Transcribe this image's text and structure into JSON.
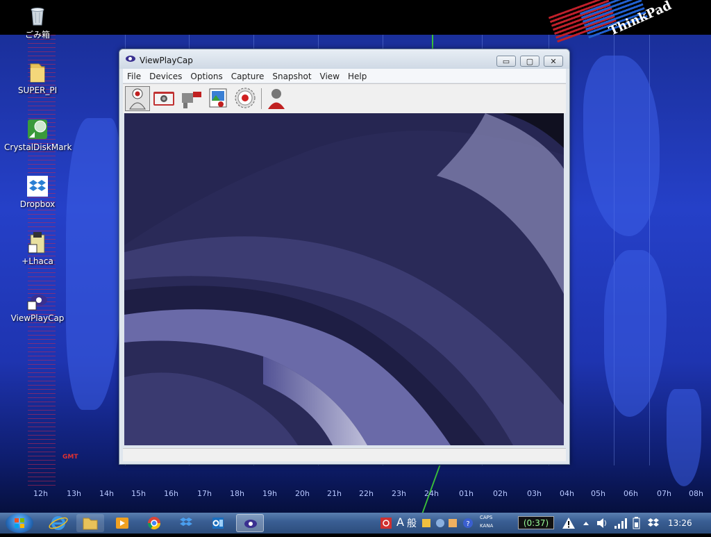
{
  "desktop": {
    "icons": [
      {
        "label": "ごみ箱",
        "icon": "recycle-bin-icon"
      },
      {
        "label": "SUPER_PI",
        "icon": "folder-icon"
      },
      {
        "label": "CrystalDiskMark",
        "icon": "crystaldiskmark-icon"
      },
      {
        "label": "Dropbox",
        "icon": "dropbox-icon"
      },
      {
        "label": "+Lhaca",
        "icon": "lhaca-icon"
      },
      {
        "label": "ViewPlayCap",
        "icon": "viewplaycap-icon"
      }
    ],
    "wallpaper": {
      "brand": "ThinkPad",
      "gmt_label": "GMT",
      "hours": [
        "12h",
        "13h",
        "14h",
        "15h",
        "16h",
        "17h",
        "18h",
        "19h",
        "20h",
        "21h",
        "22h",
        "23h",
        "24h",
        "01h",
        "02h",
        "03h",
        "04h",
        "05h",
        "06h",
        "07h",
        "08h"
      ]
    }
  },
  "window": {
    "title": "ViewPlayCap",
    "controls": {
      "minimize": "▭",
      "maximize": "▢",
      "close": "✕"
    },
    "menu": [
      "File",
      "Devices",
      "Options",
      "Capture",
      "Snapshot",
      "View",
      "Help"
    ],
    "toolbar": [
      {
        "name": "webcam-icon",
        "active": true
      },
      {
        "name": "camera-icon",
        "active": false
      },
      {
        "name": "video-camera-icon",
        "active": false
      },
      {
        "name": "image-settings-icon",
        "active": false
      },
      {
        "name": "record-icon",
        "active": false
      },
      {
        "name": "user-icon",
        "active": false
      }
    ]
  },
  "taskbar": {
    "apps": [
      "internet-explorer-icon",
      "file-explorer-icon",
      "media-player-icon",
      "chrome-icon",
      "dropbox-icon",
      "outlook-icon",
      "viewplaycap-icon"
    ],
    "active_app": "viewplaycap-icon",
    "ime": {
      "mode": "A",
      "type": "般"
    },
    "caps": "CAPS",
    "kana": "KANA",
    "battery": "(0:37)",
    "clock": "13:26"
  },
  "colors": {
    "accent": "#3a5f94",
    "window_bg": "#dfe6ee",
    "video_tint": "#2c2c5c"
  }
}
